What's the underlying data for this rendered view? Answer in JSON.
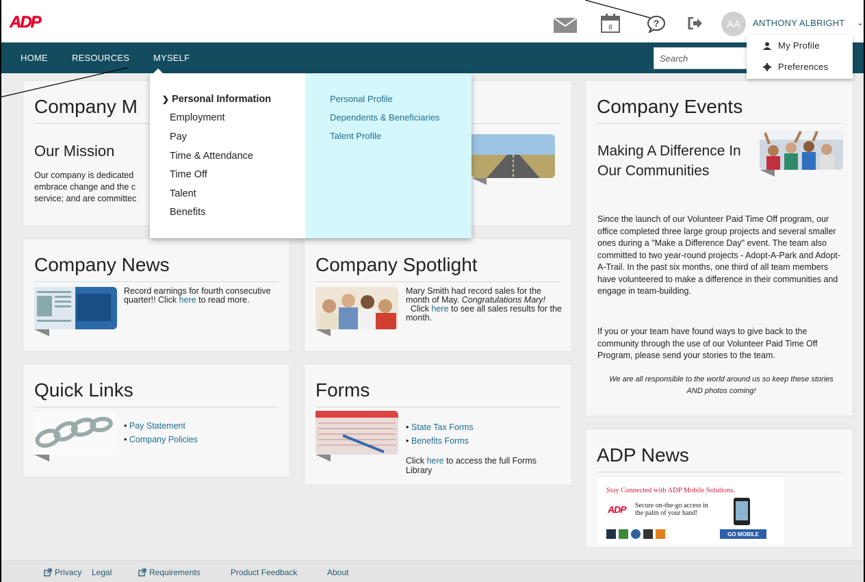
{
  "header": {
    "logo_text": "ADP",
    "user_initials": "AA",
    "user_name": "ANTHONY ALBRIGHT",
    "icons": [
      "mail-icon",
      "calendar-icon",
      "help-icon",
      "logout-icon"
    ],
    "calendar_day": "8"
  },
  "nav": {
    "items": [
      "HOME",
      "RESOURCES",
      "MYSELF"
    ],
    "search_placeholder": "Search"
  },
  "user_menu": {
    "items": [
      {
        "label": "My Profile",
        "icon": "person-icon"
      },
      {
        "label": "Preferences",
        "icon": "gear-icon"
      }
    ]
  },
  "myself_menu": {
    "categories": [
      "Personal Information",
      "Employment",
      "Pay",
      "Time & Attendance",
      "Time Off",
      "Talent",
      "Benefits"
    ],
    "active_category": "Personal Information",
    "sub_links": [
      "Personal Profile",
      "Dependents & Beneficiaries",
      "Talent Profile"
    ]
  },
  "company_mission": {
    "title": "Company M",
    "subtitle": "Our Mission",
    "lines": [
      "Our company is dedicated",
      "embrace change and the c",
      "service; and are committec"
    ]
  },
  "company_news": {
    "title": "Company News",
    "text_before": "Record earnings for fourth consecutive quarter!! Click ",
    "link": "here",
    "text_after": " to read more."
  },
  "company_spotlight": {
    "title": "Company Spotlight",
    "text_before": "Mary Smith had record sales for the month of May. ",
    "italic": "Congratulations Mary!",
    "text_mid": "  Click ",
    "link": "here",
    "text_after": " to see all sales results for the month."
  },
  "quick_links": {
    "title": "Quick Links",
    "links": [
      "Pay Statement",
      "Company Policies"
    ]
  },
  "forms": {
    "title": "Forms",
    "links": [
      "State Tax Forms",
      "Benefits Forms"
    ],
    "text_before": "Click ",
    "link": "here",
    "text_after": " to access the full Forms Library"
  },
  "company_events": {
    "title": "Company Events",
    "subtitle": "Making A Difference In Our Communities",
    "para1": "Since the launch of our Volunteer Paid Time Off program, our office completed three large group projects and several smaller ones during a \"Make a Difference Day\" event.  The team also committed to two year-round projects - Adopt-A-Park and Adopt-A-Trail.  In the past six months, one third of all team members have volunteered to make a difference in their communities and engage in team-building.",
    "para2": "If you or your team have found ways to give back to the community through the use of our Volunteer Paid Time Off Program, please send your stories to the team.",
    "quote": "We are all responsible to the world around us so keep these stories AND photos coming!"
  },
  "adp_news": {
    "title": "ADP News",
    "banner_headline": "Stay Connected with ADP Mobile Solutions.",
    "banner_tagline": "Secure on-the-go access in the palm of your hand!",
    "banner_button": "GO MOBILE"
  },
  "footer": {
    "items": [
      "Privacy",
      "Legal",
      "Requirements",
      "Product Feedback",
      "About"
    ]
  },
  "colors": {
    "nav_bg": "#134c5f",
    "link": "#1f6e91",
    "menu_highlight": "#d4f7fb",
    "logo_red": "#e4002b"
  }
}
